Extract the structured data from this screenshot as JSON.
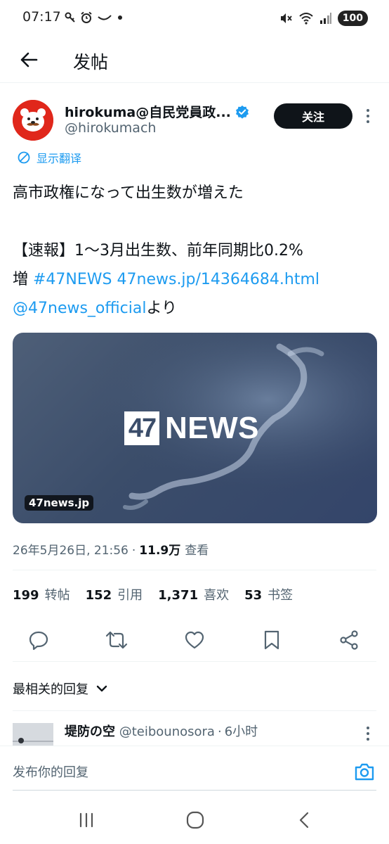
{
  "status_bar": {
    "time": "07:17",
    "battery": "100"
  },
  "top_bar": {
    "title": "发帖"
  },
  "tweet": {
    "author_name": "hirokuma@自民党員政...",
    "author_handle": "@hirokumach",
    "follow_label": "关注",
    "translate_label": "显示翻译",
    "text": {
      "line1": "高市政権になって出生数が増えた",
      "line2": "【速報】1～3月出生数、前年同期比0.2%",
      "line3_prefix": "増 ",
      "hashtag": "#47NEWS",
      "url": "47news.jp/14364684.html",
      "mention": "@47news_official",
      "mention_suffix": "より"
    },
    "card": {
      "logo_number": "47",
      "logo_word": "NEWS",
      "domain": "47news.jp"
    },
    "meta": {
      "timestamp": "26年5月26日, 21:56",
      "separator": "·",
      "views": "11.9万",
      "views_label": "查看"
    },
    "stats": [
      {
        "value": "199",
        "label": "转帖"
      },
      {
        "value": "152",
        "label": "引用"
      },
      {
        "value": "1,371",
        "label": "喜欢"
      },
      {
        "value": "53",
        "label": "书签"
      }
    ]
  },
  "replies": {
    "sort_label": "最相关的回复",
    "first_reply": {
      "name": "堤防の空",
      "handle": "@teibounosora",
      "separator": "·",
      "time": "6小时"
    }
  },
  "composer": {
    "placeholder": "发布你的回复"
  },
  "colors": {
    "accent": "#1d9bf0",
    "text_primary": "#0f1419",
    "text_secondary": "#536471",
    "avatar_red": "#e0271b",
    "card_bg": "#3b4d6a"
  }
}
